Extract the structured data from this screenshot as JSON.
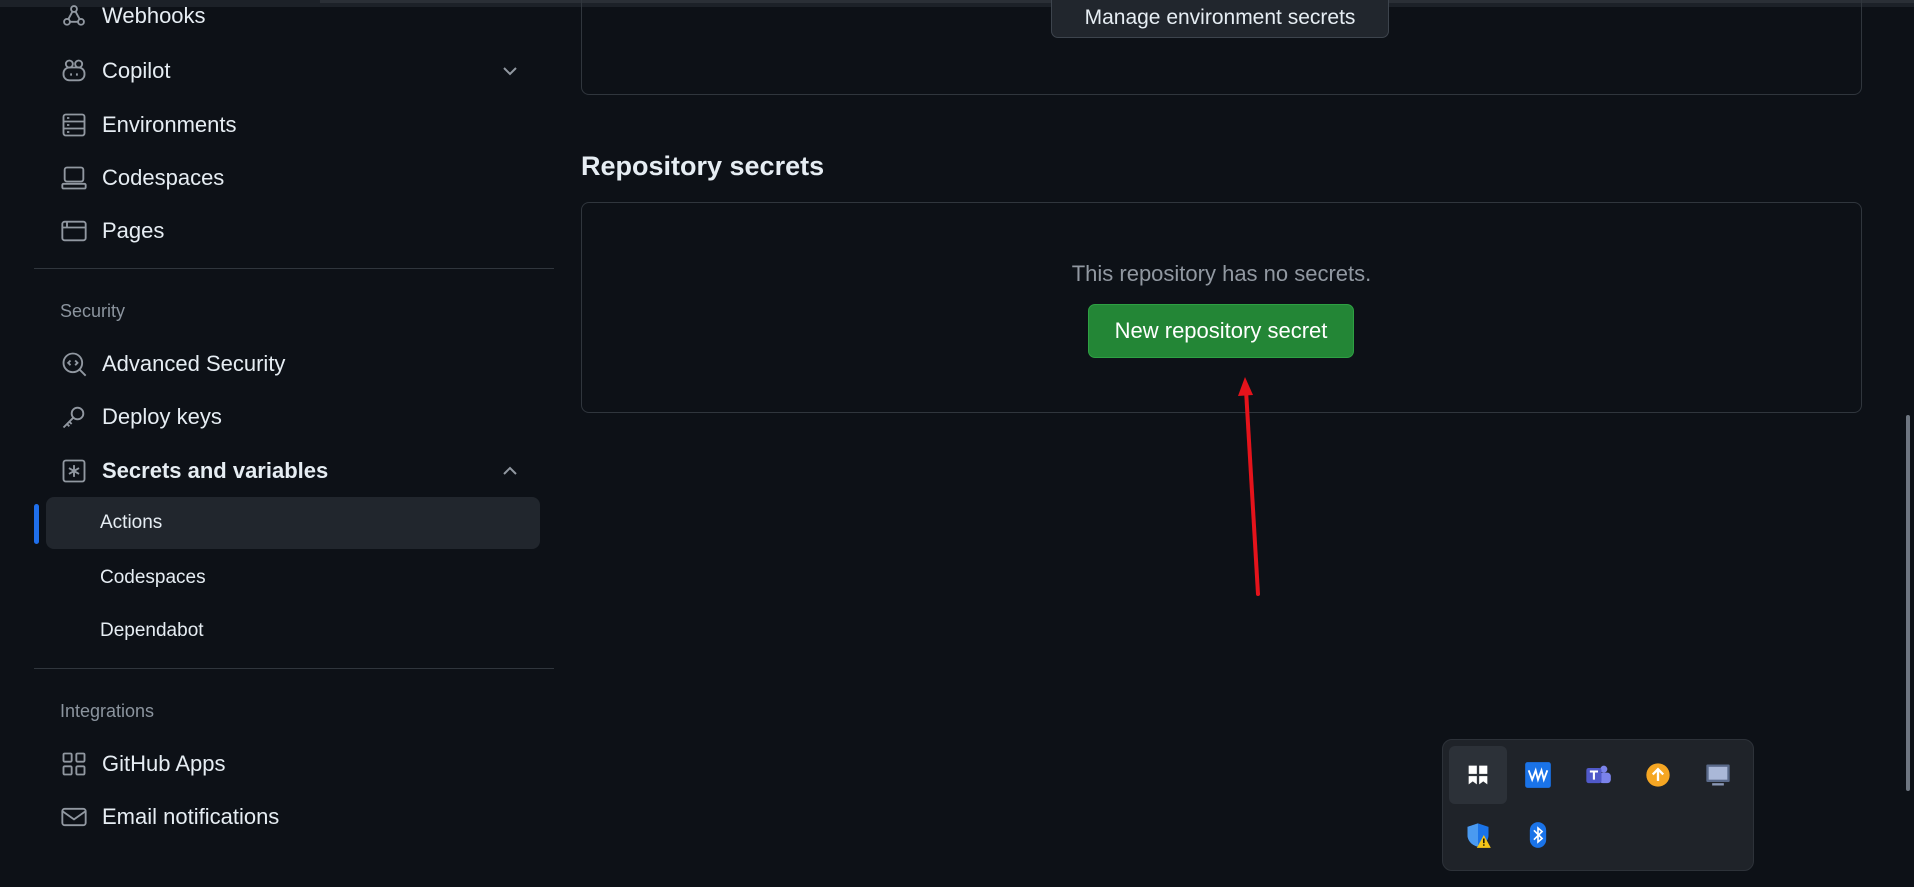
{
  "sidebar": {
    "items_top": [
      {
        "label": "Webhooks",
        "icon": "webhook-icon"
      },
      {
        "label": "Copilot",
        "icon": "copilot-icon"
      },
      {
        "label": "Environments",
        "icon": "server-icon"
      },
      {
        "label": "Codespaces",
        "icon": "codespaces-icon"
      },
      {
        "label": "Pages",
        "icon": "browser-icon"
      }
    ],
    "security_label": "Security",
    "security_items": [
      {
        "label": "Advanced Security",
        "icon": "codescan-icon"
      },
      {
        "label": "Deploy keys",
        "icon": "key-icon"
      },
      {
        "label": "Secrets and variables",
        "icon": "asterisk-icon"
      }
    ],
    "secrets_sub": [
      "Actions",
      "Codespaces",
      "Dependabot"
    ],
    "integrations_label": "Integrations",
    "integration_items": [
      {
        "label": "GitHub Apps",
        "icon": "apps-icon"
      },
      {
        "label": "Email notifications",
        "icon": "mail-icon"
      }
    ]
  },
  "main": {
    "manage_env_button": "Manage environment secrets",
    "repo_secrets_title": "Repository secrets",
    "empty_message": "This repository has no secrets.",
    "new_secret_button": "New repository secret"
  },
  "colors": {
    "background": "#0d1117",
    "primary_button": "#238636",
    "active_indicator": "#1f6feb",
    "annotation_arrow": "#e5131b"
  },
  "tray": {
    "icons": [
      "snipping-icon",
      "waves-icon",
      "teams-icon",
      "update-icon",
      "display-icon",
      "defender-warning-icon",
      "bluetooth-icon"
    ]
  }
}
